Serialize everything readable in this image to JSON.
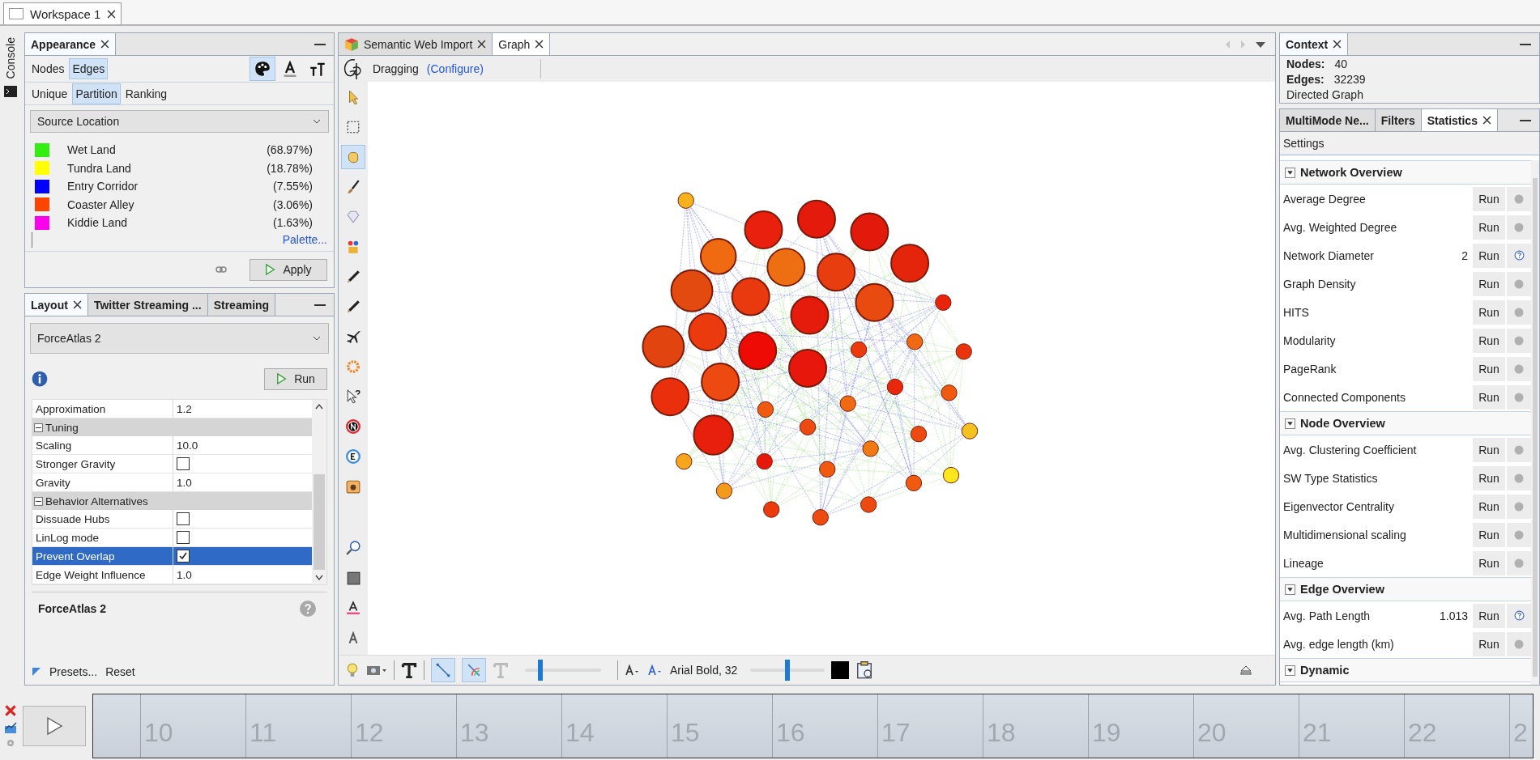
{
  "workspace_tabs": [
    {
      "label": "Workspace 1",
      "selected": true
    }
  ],
  "side_strip": {
    "label": "Console"
  },
  "appearance": {
    "title": "Appearance",
    "target_tabs": [
      {
        "label": "Nodes",
        "selected": false
      },
      {
        "label": "Edges",
        "selected": true
      }
    ],
    "attribute_tools": [
      {
        "kind": "color",
        "selected": true
      },
      {
        "kind": "label",
        "selected": false
      },
      {
        "kind": "size",
        "selected": false
      }
    ],
    "mode_tabs": [
      {
        "label": "Unique",
        "selected": false
      },
      {
        "label": "Partition",
        "selected": true
      },
      {
        "label": "Ranking",
        "selected": false
      }
    ],
    "attribute": "Source Location",
    "partitions": [
      {
        "label": "Wet Land",
        "share": "(68.97%)",
        "color": "#33ee11"
      },
      {
        "label": "Tundra Land",
        "share": "(18.78%)",
        "color": "#ffff00"
      },
      {
        "label": "Entry Corridor",
        "share": "(7.55%)",
        "color": "#0000ff"
      },
      {
        "label": "Coaster Alley",
        "share": "(3.06%)",
        "color": "#ff4400"
      },
      {
        "label": "Kiddie Land",
        "share": "(1.63%)",
        "color": "#ff00ee"
      }
    ],
    "palette_link": "Palette...",
    "apply": "Apply"
  },
  "layout": {
    "tabs": [
      {
        "label": "Layout",
        "selected": true,
        "closable": true
      },
      {
        "label": "Twitter Streaming ...",
        "selected": false,
        "closable": false
      },
      {
        "label": "Streaming",
        "selected": false,
        "closable": false
      }
    ],
    "algorithm": "ForceAtlas 2",
    "run": "Run",
    "properties": [
      {
        "kind": "value",
        "name": "Approximation",
        "value": "1.2",
        "selected": false
      },
      {
        "kind": "section",
        "name": "Tuning",
        "expanded": true,
        "selected": false
      },
      {
        "kind": "value",
        "name": "Scaling",
        "value": "10.0",
        "selected": false
      },
      {
        "kind": "checkbox",
        "name": "Stronger Gravity",
        "checked": false,
        "selected": false
      },
      {
        "kind": "value",
        "name": "Gravity",
        "value": "1.0",
        "selected": false
      },
      {
        "kind": "section",
        "name": "Behavior Alternatives",
        "expanded": true,
        "selected": false
      },
      {
        "kind": "checkbox",
        "name": "Dissuade Hubs",
        "checked": false,
        "selected": false
      },
      {
        "kind": "checkbox",
        "name": "LinLog mode",
        "checked": false,
        "selected": false
      },
      {
        "kind": "checkbox",
        "name": "Prevent Overlap",
        "checked": true,
        "selected": true
      },
      {
        "kind": "value",
        "name": "Edge Weight Influence",
        "value": "1.0",
        "selected": false
      }
    ],
    "description_title": "ForceAtlas 2",
    "presets": "Presets...",
    "reset": "Reset"
  },
  "graph": {
    "tabs": [
      {
        "label": "Semantic Web Import",
        "selected": false
      },
      {
        "label": "Graph",
        "selected": true
      }
    ],
    "mode": "Dragging",
    "configure": "(Configure)",
    "tools": [
      {
        "kind": "pointer",
        "selected": false
      },
      {
        "kind": "rect-select",
        "selected": false
      },
      {
        "kind": "hand",
        "selected": true
      },
      {
        "kind": "brush",
        "selected": false
      },
      {
        "kind": "diamond",
        "selected": false
      },
      {
        "kind": "painter",
        "selected": false
      },
      {
        "kind": "pencil",
        "selected": false
      },
      {
        "kind": "pencil",
        "selected": false
      },
      {
        "kind": "airplane",
        "selected": false
      },
      {
        "kind": "sun",
        "selected": false
      },
      {
        "kind": "cursor-help",
        "selected": false
      },
      {
        "kind": "n-circle",
        "selected": false
      },
      {
        "kind": "e-circle",
        "selected": false
      },
      {
        "kind": "camera",
        "selected": false
      }
    ],
    "bottom_toolbar": {
      "edge_toggles": [
        {
          "selected": true
        },
        {
          "selected": true
        }
      ],
      "sliders": [
        {
          "level": 0.2
        },
        {
          "level": 0.5
        }
      ],
      "font": "Arial Bold, 32"
    }
  },
  "context": {
    "title": "Context",
    "stats": [
      {
        "label": "Nodes:",
        "value": "40"
      },
      {
        "label": "Edges:",
        "value": "32239"
      }
    ],
    "graph_type": "Directed Graph"
  },
  "statistics": {
    "tabs": [
      {
        "label": "MultiMode Ne...",
        "selected": false
      },
      {
        "label": "Filters",
        "selected": false
      },
      {
        "label": "Statistics",
        "selected": true
      }
    ],
    "settings": "Settings",
    "sections": [
      {
        "title": "Network Overview",
        "items": [
          {
            "name": "Average Degree",
            "run": "Run",
            "report": false
          },
          {
            "name": "Avg. Weighted Degree",
            "run": "Run",
            "report": false
          },
          {
            "name": "Network Diameter",
            "result": "2",
            "run": "Run",
            "report": true
          },
          {
            "name": "Graph Density",
            "run": "Run",
            "report": false
          },
          {
            "name": "HITS",
            "run": "Run",
            "report": false
          },
          {
            "name": "Modularity",
            "run": "Run",
            "report": false
          },
          {
            "name": "PageRank",
            "run": "Run",
            "report": false
          },
          {
            "name": "Connected Components",
            "run": "Run",
            "report": false
          }
        ]
      },
      {
        "title": "Node Overview",
        "items": [
          {
            "name": "Avg. Clustering Coefficient",
            "run": "Run",
            "report": false
          },
          {
            "name": "SW Type Statistics",
            "run": "Run",
            "report": false
          },
          {
            "name": "Eigenvector Centrality",
            "run": "Run",
            "report": false
          },
          {
            "name": "Multidimensional scaling",
            "run": "Run",
            "report": false
          },
          {
            "name": "Lineage",
            "run": "Run",
            "report": false
          }
        ]
      },
      {
        "title": "Edge Overview",
        "items": [
          {
            "name": "Avg. Path Length",
            "result": "1.013",
            "run": "Run",
            "report": true
          },
          {
            "name": "Avg. edge length (km)",
            "run": "Run",
            "report": false
          }
        ]
      },
      {
        "title": "Dynamic"
      }
    ]
  },
  "timeline": {
    "ticks": [
      "10",
      "11",
      "12",
      "13",
      "14",
      "15",
      "16",
      "17",
      "18",
      "19",
      "20",
      "21",
      "22",
      "2"
    ]
  }
}
